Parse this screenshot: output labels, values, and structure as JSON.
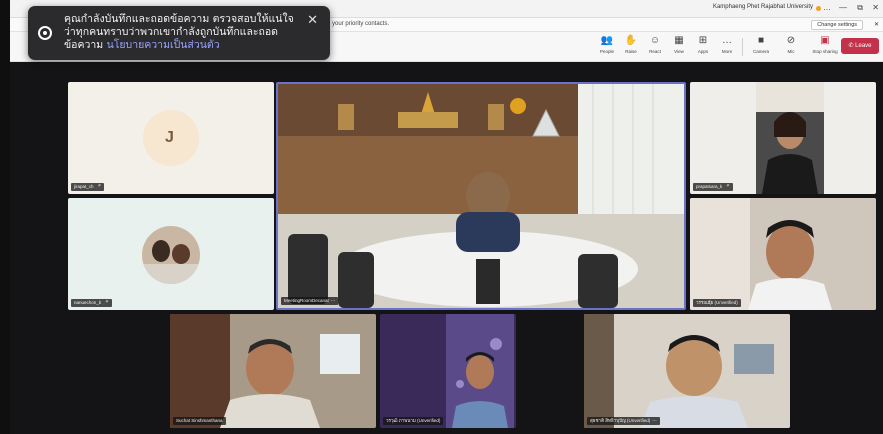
{
  "window": {
    "org_name": "Kamphaeng Phet Rajabhat University",
    "controls": [
      "…",
      "—",
      "⧉",
      "✕"
    ]
  },
  "notice": {
    "text": "rom your priority contacts.",
    "button": "Change settings",
    "close": "✕"
  },
  "toolbar": {
    "items": [
      {
        "label": "People",
        "icon": "people-icon",
        "glyph": "👥"
      },
      {
        "label": "Raise",
        "icon": "raise-hand-icon",
        "glyph": "✋"
      },
      {
        "label": "React",
        "icon": "react-icon",
        "glyph": "☺"
      },
      {
        "label": "View",
        "icon": "view-icon",
        "glyph": "▦"
      },
      {
        "label": "Apps",
        "icon": "apps-icon",
        "glyph": "⊞"
      },
      {
        "label": "More",
        "icon": "more-icon",
        "glyph": "…"
      }
    ],
    "camera_label": "Camera",
    "mic_label": "Mic",
    "share_label": "Stop sharing",
    "leave_label": "Leave"
  },
  "participants": [
    {
      "name": "jirapat_ch",
      "avatar_letter": "J"
    },
    {
      "name": "nanuechon_b"
    },
    {
      "name": "MeetingRoomDecanat"
    },
    {
      "name": "prapatsara_k"
    },
    {
      "name": "วรรณຊีย (Unverified)"
    },
    {
      "name": "Suchat Sinshmanthana"
    },
    {
      "name": "วรวุฒิ ภาพนาม (Unverified)"
    },
    {
      "name": "สุธชาติ สิทธิาบุปัญ (Unverified)"
    }
  ],
  "toast": {
    "message": "คุณกำลังบันทึกและถอดข้อความ ตรวจสอบให้แน่ใจว่าทุกคนทราบว่าพวกเขากำลังถูกบันทึกและถอดข้อความ",
    "link": "นโยบายความเป็นส่วนตัว",
    "close": "✕"
  },
  "colors": {
    "leave": "#c4314b",
    "spotlight_border": "#6b72c9",
    "toast_link": "#9aa3ff"
  }
}
